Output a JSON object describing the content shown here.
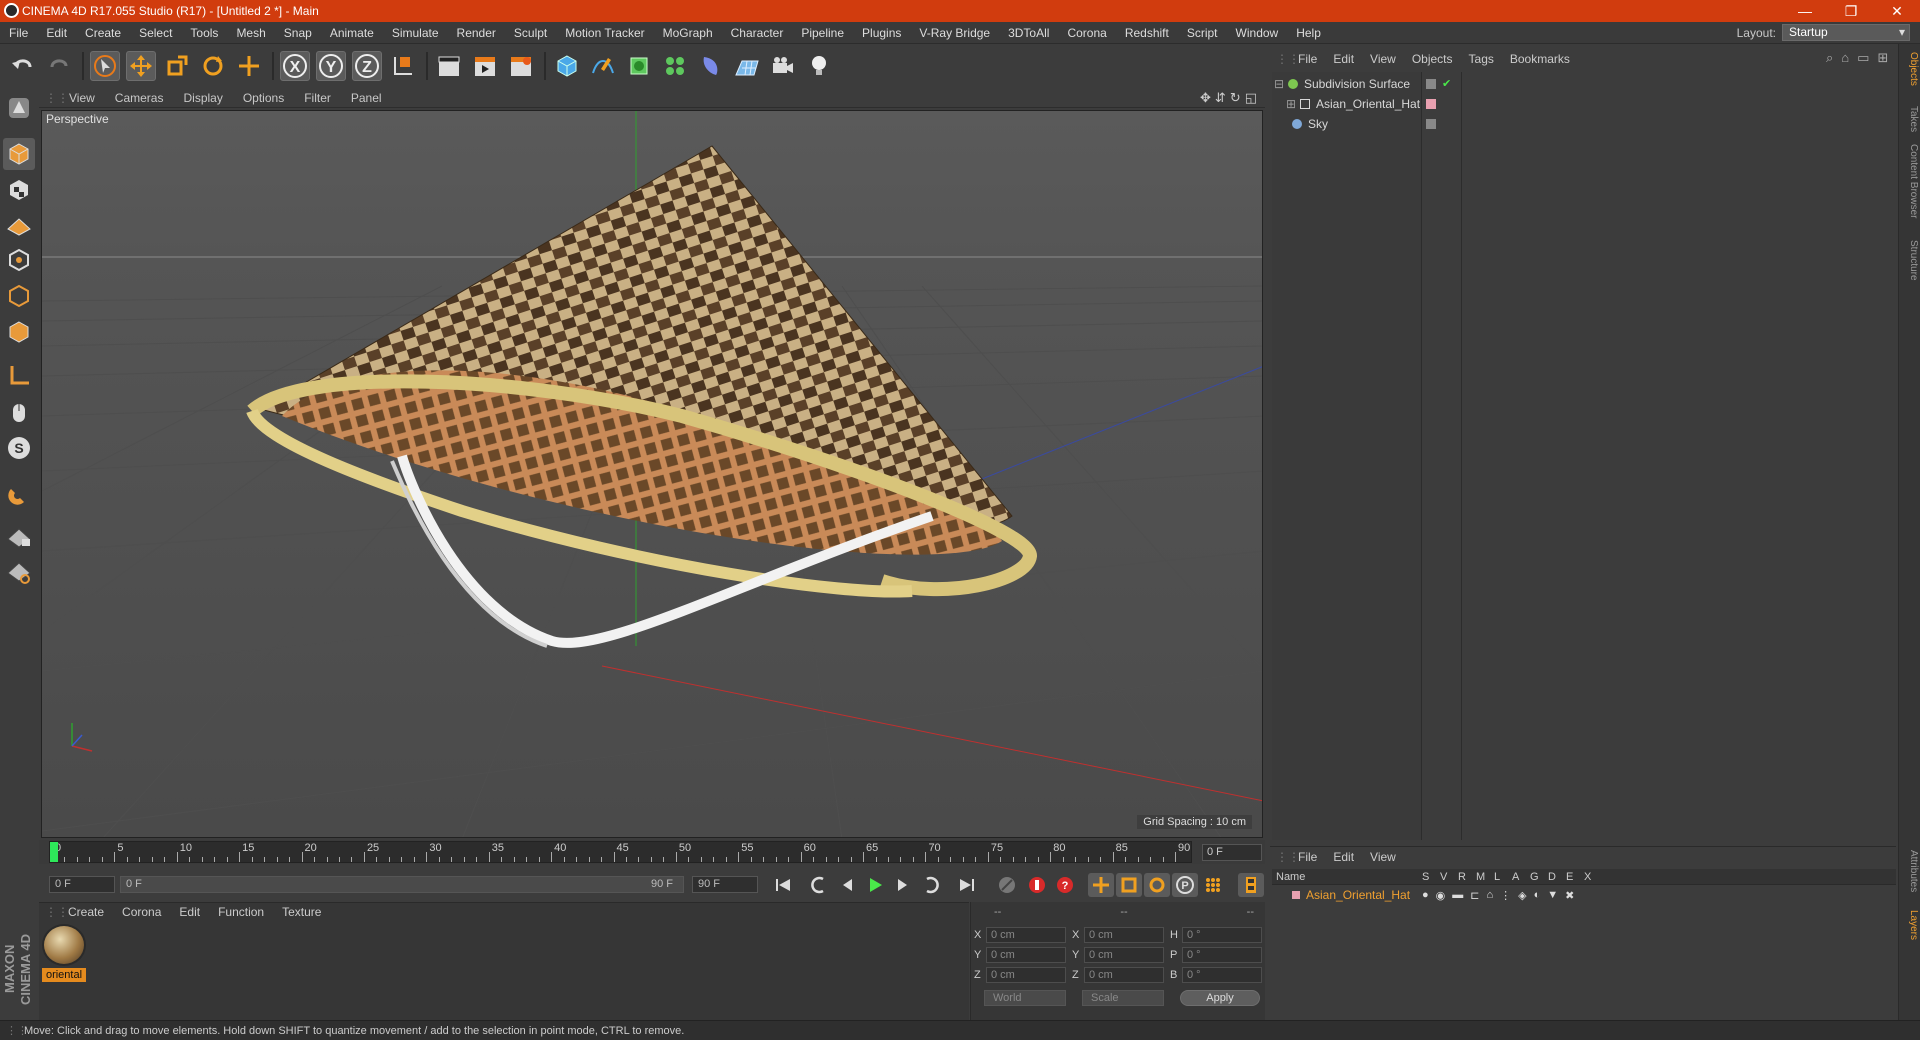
{
  "window": {
    "title": "CINEMA 4D R17.055 Studio (R17) - [Untitled 2 *] - Main",
    "minimize": "—",
    "restore": "❐",
    "close": "✕"
  },
  "menubar": [
    "File",
    "Edit",
    "Create",
    "Select",
    "Tools",
    "Mesh",
    "Snap",
    "Animate",
    "Simulate",
    "Render",
    "Sculpt",
    "Motion Tracker",
    "MoGraph",
    "Character",
    "Pipeline",
    "Plugins",
    "V-Ray Bridge",
    "3DToAll",
    "Corona",
    "Redshift",
    "Script",
    "Window",
    "Help"
  ],
  "layout": {
    "label": "Layout:",
    "value": "Startup"
  },
  "viewport": {
    "menu": [
      "View",
      "Cameras",
      "Display",
      "Options",
      "Filter",
      "Panel"
    ],
    "label": "Perspective",
    "grid_spacing": "Grid Spacing : 10 cm"
  },
  "timeline": {
    "ticks": [
      "0",
      "5",
      "10",
      "15",
      "20",
      "25",
      "30",
      "35",
      "40",
      "45",
      "50",
      "55",
      "60",
      "65",
      "70",
      "75",
      "80",
      "85",
      "90"
    ],
    "current_frame": "0 F",
    "start_field": "0 F",
    "range_start": "0 F",
    "range_end": "90 F",
    "end_field": "90 F"
  },
  "material_manager": {
    "menu": [
      "Create",
      "Corona",
      "Edit",
      "Function",
      "Texture"
    ],
    "material_name": "oriental"
  },
  "coordinates": {
    "header": [
      "--",
      "--",
      "--"
    ],
    "rows": [
      {
        "a": "X",
        "av": "0 cm",
        "b": "X",
        "bv": "0 cm",
        "c": "H",
        "cv": "0 °"
      },
      {
        "a": "Y",
        "av": "0 cm",
        "b": "Y",
        "bv": "0 cm",
        "c": "P",
        "cv": "0 °"
      },
      {
        "a": "Z",
        "av": "0 cm",
        "b": "Z",
        "bv": "0 cm",
        "c": "B",
        "cv": "0 °"
      }
    ],
    "world": "World",
    "scale": "Scale",
    "apply": "Apply"
  },
  "object_manager": {
    "menu": [
      "File",
      "Edit",
      "View",
      "Objects",
      "Tags",
      "Bookmarks"
    ],
    "items": [
      {
        "name": "Subdivision Surface",
        "color": "#7ec850"
      },
      {
        "name": "Asian_Oriental_Hat",
        "color": "#d8d8d8"
      },
      {
        "name": "Sky",
        "color": "#7fa8d8"
      }
    ]
  },
  "layer_manager": {
    "menu": [
      "File",
      "Edit",
      "View"
    ],
    "columns": [
      "Name",
      "S",
      "V",
      "R",
      "M",
      "L",
      "A",
      "G",
      "D",
      "E",
      "X"
    ],
    "row_name": "Asian_Oriental_Hat"
  },
  "right_tabs": [
    "Objects",
    "Takes",
    "Content Browser",
    "Structure",
    "Attributes",
    "Layers"
  ],
  "brand": "MAXON CINEMA 4D",
  "status": "Move: Click and drag to move elements. Hold down SHIFT to quantize movement / add to the selection in point mode, CTRL to remove.",
  "colors": {
    "titlebar": "#d13c0e",
    "accent": "#e58b1e",
    "active_layer_text": "#f0a030"
  }
}
